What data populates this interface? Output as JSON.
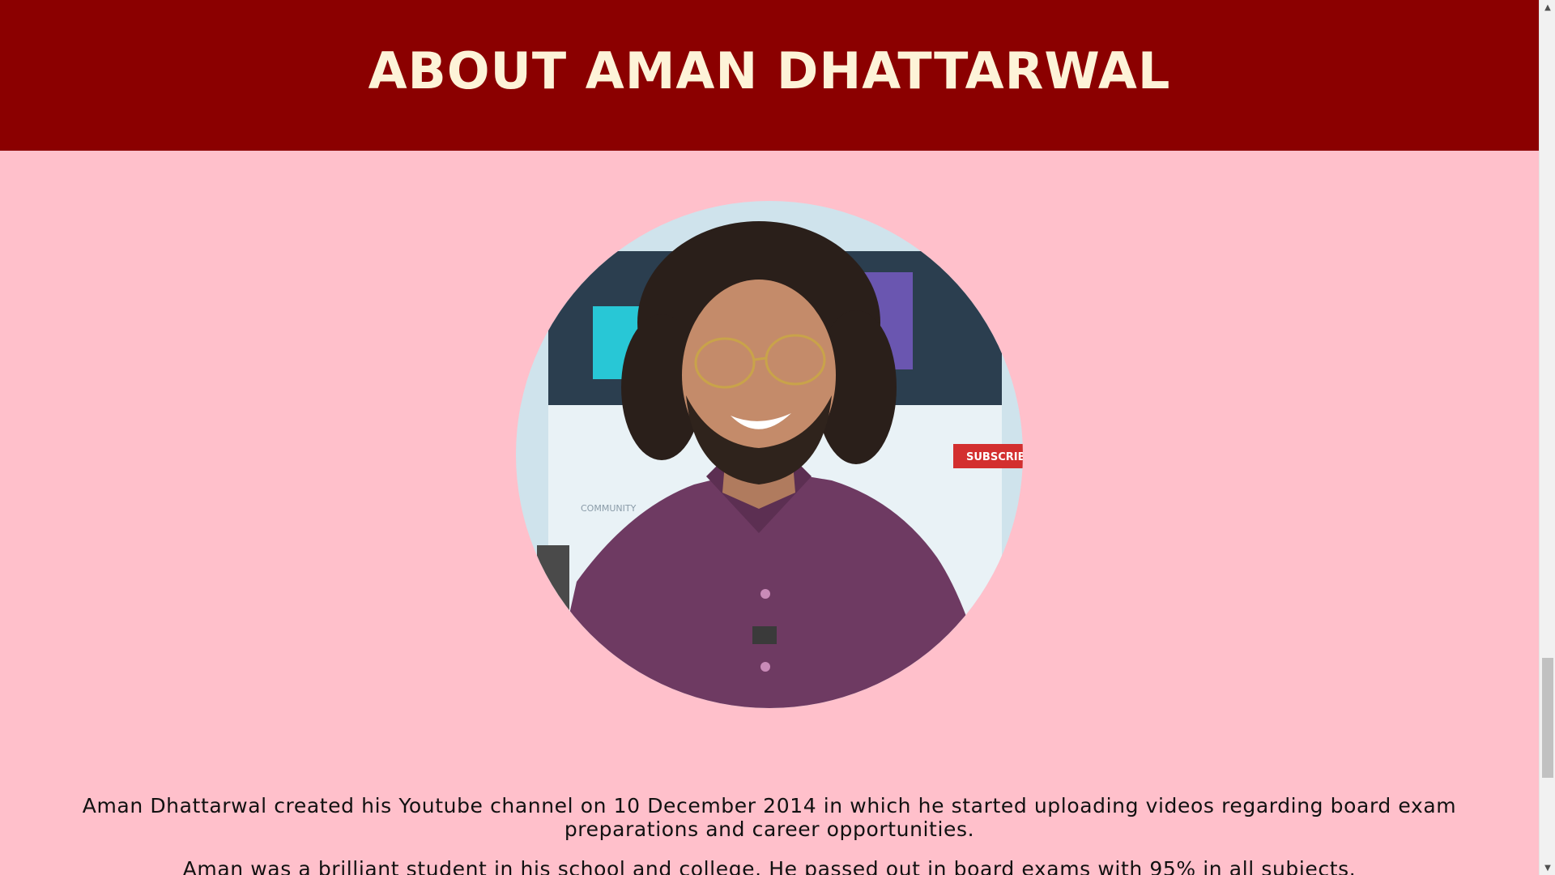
{
  "header": {
    "title": "ABOUT AMAN DHATTARWAL"
  },
  "portrait": {
    "background_labels": {
      "subscribe": "SUBSCRIBE",
      "community": "COMMUNITY"
    }
  },
  "bio": {
    "paragraphs": [
      "Aman Dhattarwal created his Youtube channel on 10 December 2014 in which he started uploading videos regarding board exam preparations and career opportunities.",
      "Aman was a brilliant student in his school and college. He passed out in board exams with 95% in all subjects."
    ]
  },
  "scrollbar": {
    "up_icon": "▲",
    "down_icon": "▼"
  },
  "colors": {
    "header_bg": "#8b0000",
    "header_text": "#fdf3d8",
    "page_bg": "#ffc0cb",
    "body_text": "#111111"
  }
}
